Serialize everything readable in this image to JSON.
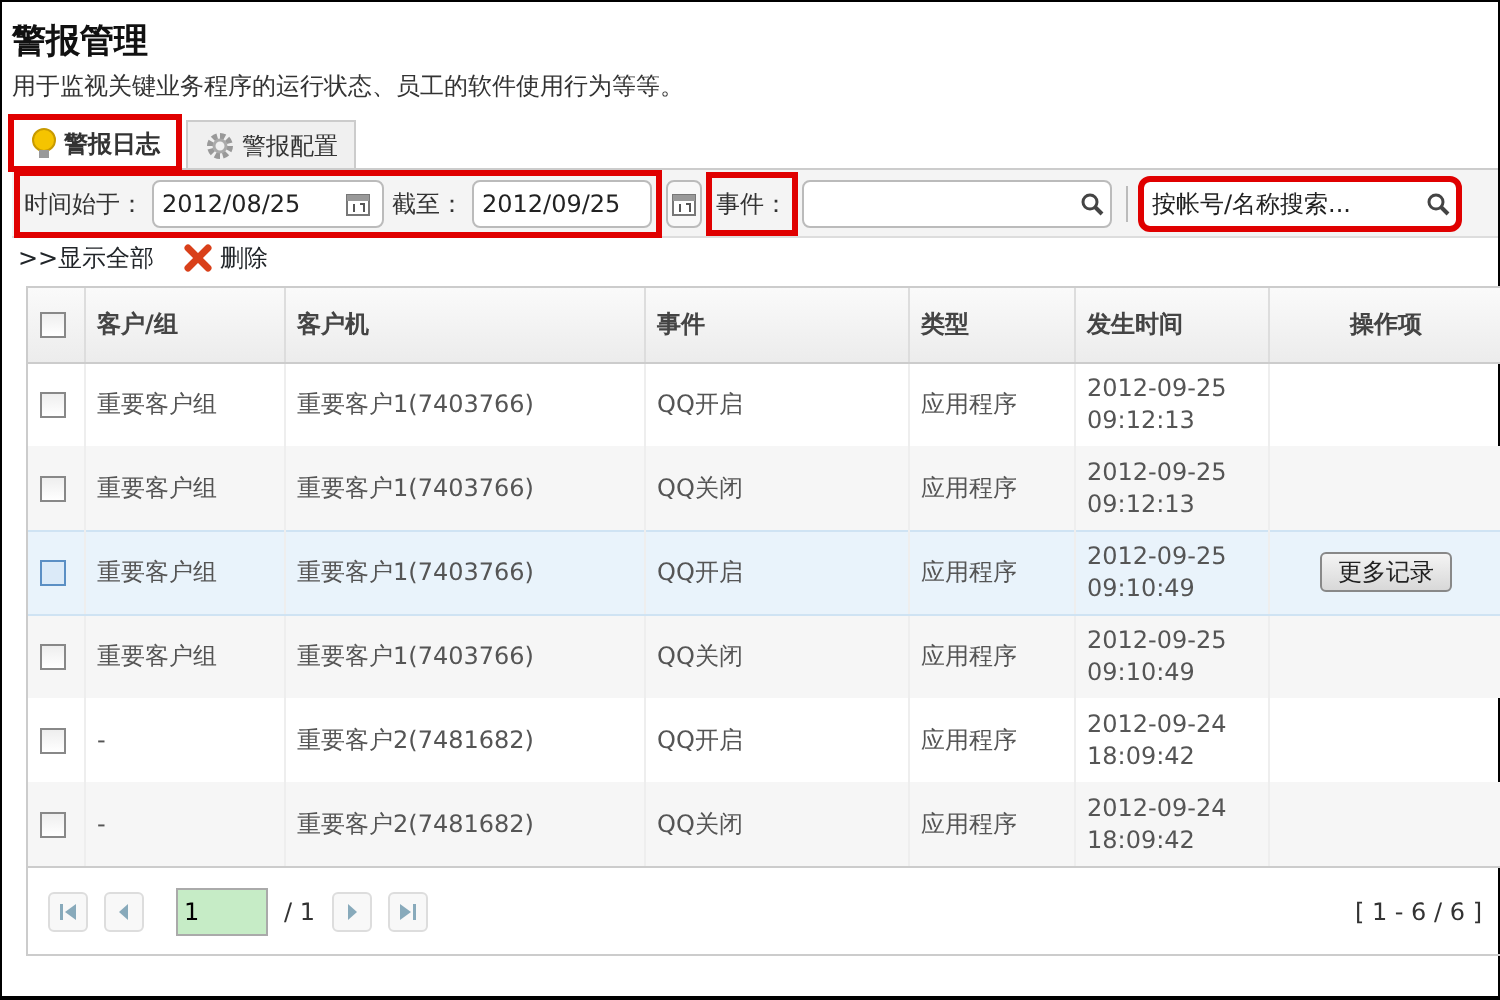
{
  "page": {
    "title": "警报管理",
    "description": "用于监视关键业务程序的运行状态、员工的软件使用行为等等。"
  },
  "tabs": [
    {
      "label": "警报日志",
      "selected": true,
      "highlighted": true
    },
    {
      "label": "警报配置",
      "selected": false,
      "highlighted": false
    }
  ],
  "filters": {
    "start_label": "时间始于：",
    "start_value": "2012/08/25",
    "end_label": "截至：",
    "end_value": "2012/09/25",
    "dates_highlighted": true,
    "event_label": "事件：",
    "event_highlighted": true,
    "search_placeholder": "按帐号/名称搜索...",
    "search_highlighted": true
  },
  "actions": {
    "show_all": ">>显示全部",
    "delete": "删除"
  },
  "table": {
    "all_checked": false,
    "columns": [
      "客户/组",
      "客户机",
      "事件",
      "类型",
      "发生时间",
      "操作项"
    ],
    "rows": [
      {
        "group": "重要客户组",
        "client": "重要客户1(7403766)",
        "event": "QQ开启",
        "type": "应用程序",
        "date": "2012-09-25",
        "time": "09:12:13",
        "selected": false,
        "checked": false
      },
      {
        "group": "重要客户组",
        "client": "重要客户1(7403766)",
        "event": "QQ关闭",
        "type": "应用程序",
        "date": "2012-09-25",
        "time": "09:12:13",
        "selected": false,
        "checked": false
      },
      {
        "group": "重要客户组",
        "client": "重要客户1(7403766)",
        "event": "QQ开启",
        "type": "应用程序",
        "date": "2012-09-25",
        "time": "09:10:49",
        "selected": true,
        "checked": false,
        "action": "更多记录"
      },
      {
        "group": "重要客户组",
        "client": "重要客户1(7403766)",
        "event": "QQ关闭",
        "type": "应用程序",
        "date": "2012-09-25",
        "time": "09:10:49",
        "selected": false,
        "checked": false
      },
      {
        "group": "-",
        "client": "重要客户2(7481682)",
        "event": "QQ开启",
        "type": "应用程序",
        "date": "2012-09-24",
        "time": "18:09:42",
        "selected": false,
        "checked": false
      },
      {
        "group": "-",
        "client": "重要客户2(7481682)",
        "event": "QQ关闭",
        "type": "应用程序",
        "date": "2012-09-24",
        "time": "18:09:42",
        "selected": false,
        "checked": false
      }
    ]
  },
  "pager": {
    "page": "1",
    "total": "/ 1",
    "summary": "[ 1 - 6 / 6 ]"
  }
}
